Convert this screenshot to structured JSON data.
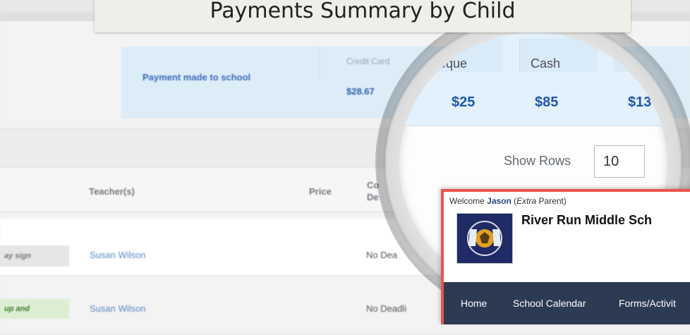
{
  "title": "Payments Summary by  Child",
  "summary": {
    "label": "Payment made to school",
    "credit_card_label": "Credit Card",
    "credit_card_value": "$28.67"
  },
  "table": {
    "headers": {
      "teacher": "Teacher(s)",
      "price": "Price",
      "deadline": "Co De"
    },
    "rows": [
      {
        "chip": "ay sign",
        "teacher": "Susan Wilson",
        "deadline": "No Dea"
      },
      {
        "chip": "up and",
        "teacher": "Susan Wilson",
        "deadline": "No Deadli"
      }
    ]
  },
  "lens": {
    "cols": [
      {
        "label": "ieque",
        "value": "$25"
      },
      {
        "label": "Cash",
        "value": "$85"
      },
      {
        "label": "",
        "value": "$13"
      }
    ],
    "show_rows_label": "Show Rows",
    "rows_value": "10"
  },
  "inset": {
    "welcome_prefix": "Welcome",
    "user_name": "Jason",
    "role": "Extra",
    "role_suffix": "Parent",
    "school_name": "River Run Middle Sch",
    "nav": [
      "Home",
      "School Calendar",
      "Forms/Activit"
    ],
    "colors": {
      "border": "#e9534f",
      "nav_bg": "#2d3b52",
      "logo_bg": "#1f2a66"
    }
  }
}
